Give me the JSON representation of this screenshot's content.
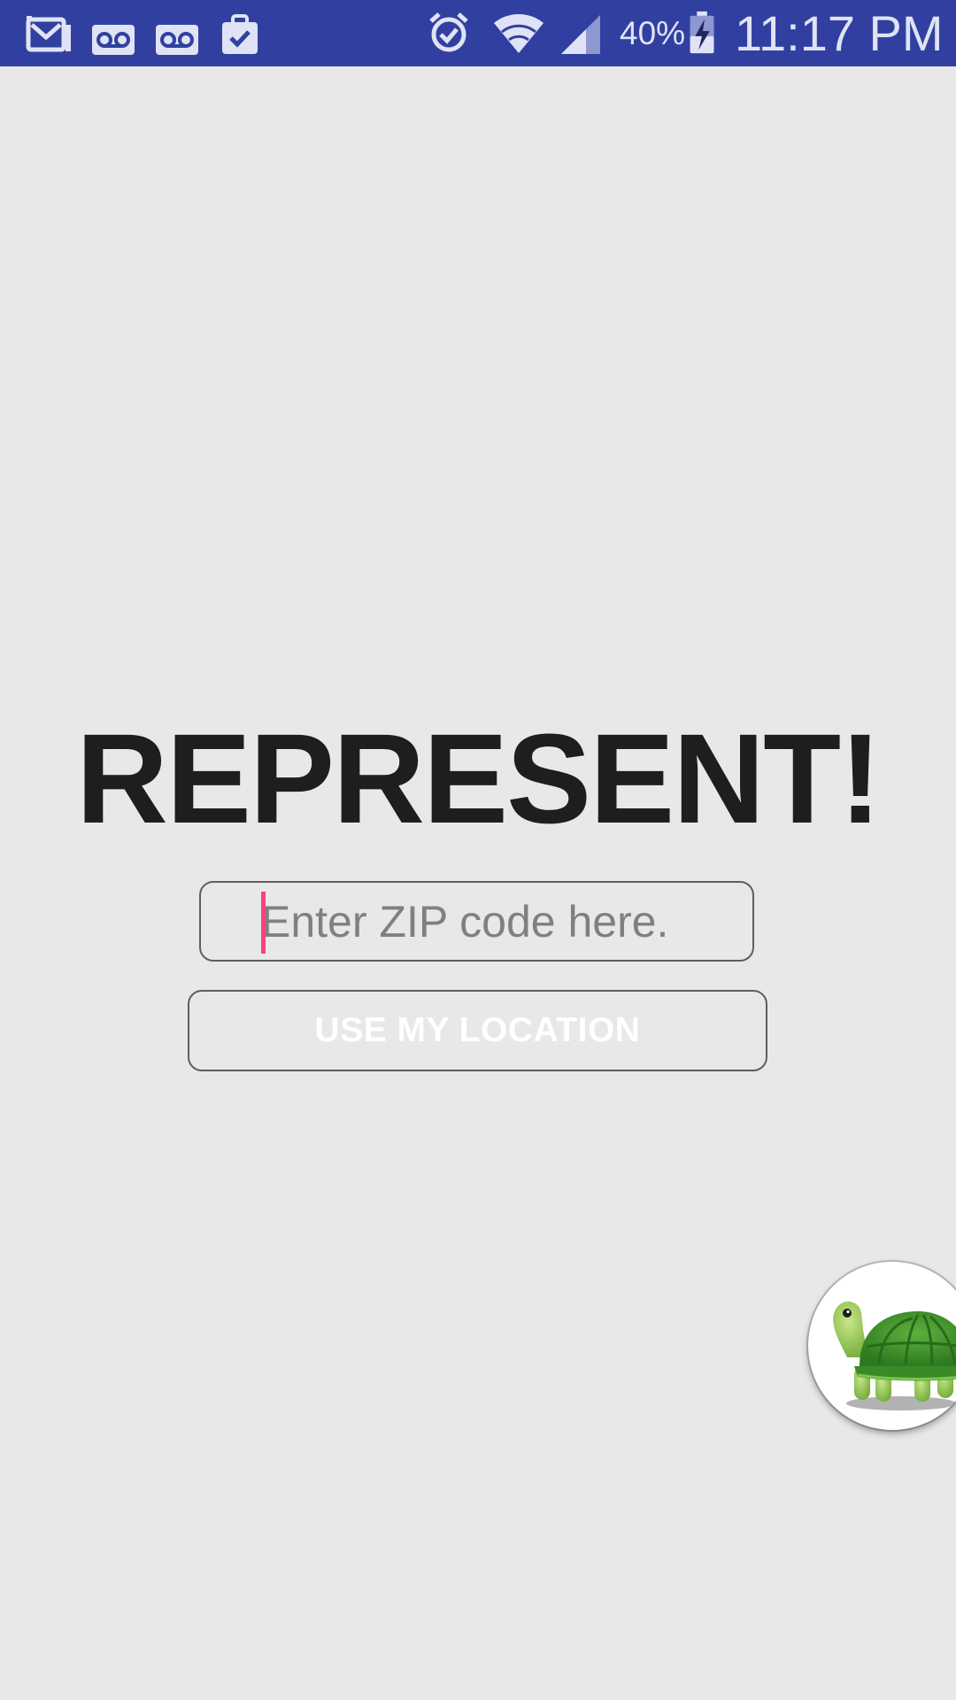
{
  "status_bar": {
    "color": "#3140a0",
    "left_icons": [
      "gmail-icon",
      "voicemail-icon",
      "voicemail-icon",
      "clipboard-check-icon"
    ],
    "right_icons": [
      "alarm-icon",
      "wifi-icon",
      "signal-icon",
      "battery-charging-icon"
    ],
    "battery_percent": "40%",
    "time": "11:17 PM"
  },
  "main": {
    "title": "REPRESENT!",
    "zip_input": {
      "placeholder": "Enter ZIP code here.",
      "value": ""
    },
    "location_button_label": "USE MY LOCATION",
    "accent_color": "#ff4081"
  },
  "floating_bubble": {
    "icon": "turtle-icon"
  }
}
